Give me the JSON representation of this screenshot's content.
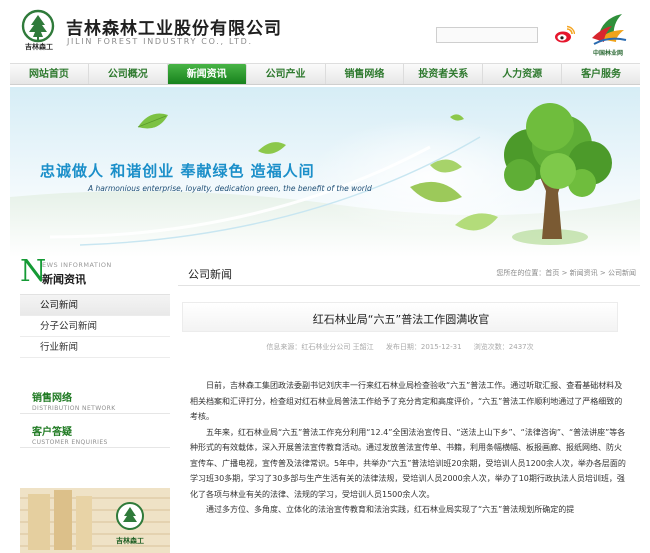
{
  "header": {
    "logo_caption": "吉林森工",
    "company_name_cn": "吉林森林工业股份有限公司",
    "company_name_en": "JILIN FOREST INDUSTRY CO., LTD.",
    "search_placeholder": "",
    "partner_logo_caption": "中国林业网",
    "icons": [
      "logo-tree-icon",
      "search-input",
      "weibo-icon",
      "china-forestry-logo"
    ]
  },
  "nav": {
    "items": [
      {
        "label": "网站首页"
      },
      {
        "label": "公司概况"
      },
      {
        "label": "新闻资讯",
        "active": true
      },
      {
        "label": "公司产业"
      },
      {
        "label": "销售网络"
      },
      {
        "label": "投资者关系"
      },
      {
        "label": "人力资源"
      },
      {
        "label": "客户服务"
      }
    ]
  },
  "banner": {
    "slogan": "忠诚做人  和谐创业  奉献绿色  造福人间",
    "slogan_en": "A harmonious enterprise, loyalty, dedication green, the benefit of the world"
  },
  "sidebar": {
    "head_letter": "N",
    "head_en": "EWS INFORMATION",
    "head_cn": "新闻资讯",
    "menu": [
      {
        "label": "公司新闻",
        "active": true
      },
      {
        "label": "分子公司新闻"
      },
      {
        "label": "行业新闻"
      }
    ],
    "sales_cn": "销售网络",
    "sales_en": "DISTRIBUTION NETWORK",
    "customer_cn": "客户答疑",
    "customer_en": "CUSTOMER ENQUIRIES",
    "photo_caption": "吉林森工"
  },
  "main": {
    "section_title": "公司新闻",
    "breadcrumb": {
      "prefix": "您所在的位置：",
      "path": "首页 > 新闻资讯 > 公司新闻"
    },
    "article": {
      "title": "红石林业局“六五”普法工作圆满收官",
      "meta_source": "信息来源：红石林业分公司 王韶江",
      "meta_date": "发布日期：2015-12-31",
      "meta_views": "浏览次数：2437次",
      "paragraphs": [
        "日前，吉林森工集团政法委副书记刘庆丰一行来红石林业局检查验收“六五”普法工作。通过听取汇报、查看基础材料及相关档案和汇评打分，检查组对红石林业局普法工作给予了充分肯定和高度评价，“六五”普法工作顺利地通过了严格细致的考核。",
        "五年来，红石林业局“六五”普法工作充分利用“12.4”全国法治宣传日、“送法上山下乡”、“法律咨询”、“普法讲座”等各种形式的有效载体，深入开展普法宣传教育活动。通过发放普法宣传单、书籍，利用条幅横幅、板报画廊、报纸网络、防火宣传车、广播电视，宣传普及法律常识。5年中，共举办“六五”普法培训班20余期，受培训人员1200余人次，举办各层面的学习班30多期，学习了30多部与生产生活有关的法律法规，受培训人员2000余人次，举办了10期行政执法人员培训班，强化了各项与林业有关的法律、法规的学习，受培训人员1500余人次。",
        "通过多方位、多角度、立体化的法治宣传教育和法治实践，红石林业局实现了“六五”普法规划所确定的提"
      ]
    }
  },
  "colors": {
    "brand_green": "#17821d",
    "nav_text": "#2f7a2f",
    "slogan_blue": "#1b8fc9"
  }
}
